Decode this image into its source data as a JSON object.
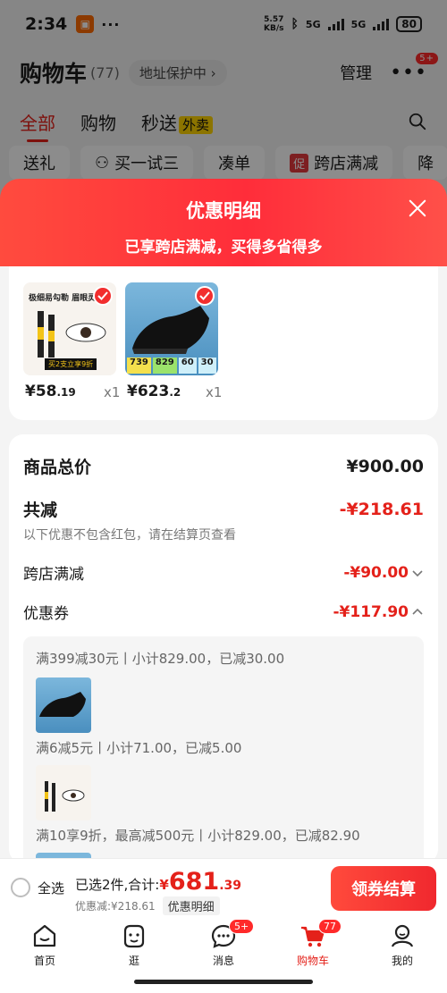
{
  "status": {
    "time": "2:34",
    "net_speed": "5.57\nKB/s",
    "net": "5G",
    "battery": "80"
  },
  "header": {
    "title": "购物车",
    "count": "(77)",
    "address": "地址保护中 ›",
    "manage": "管理",
    "more_badge": "5+"
  },
  "tabs": [
    {
      "label": "全部"
    },
    {
      "label": "购物"
    },
    {
      "label": "秒送"
    }
  ],
  "tab_tag": "外卖",
  "filters": [
    {
      "label": "送礼"
    },
    {
      "label": "买一试三"
    },
    {
      "label": "凑单"
    },
    {
      "label": "跨店满减",
      "badge": "促"
    },
    {
      "label": "降"
    }
  ],
  "sheet": {
    "title": "优惠明细",
    "subtitle": "已享跨店满减，买得多省得多"
  },
  "products": [
    {
      "price_int": "¥58",
      "price_dec": ".19",
      "qty": "x1",
      "img_title": "极细易勾勒 眉眼灵动",
      "img_promo": "买2支立享9折"
    },
    {
      "price_int": "¥623",
      "price_dec": ".2",
      "qty": "x1",
      "img_prices": [
        "739",
        "829",
        "60",
        "30"
      ]
    }
  ],
  "summary": {
    "total_label": "商品总价",
    "total_value": "¥900.00",
    "reduce_label": "共减",
    "reduce_value": "-¥218.61",
    "note": "以下优惠不包含红包，请在结算页查看",
    "cross_label": "跨店满减",
    "cross_value": "-¥90.00",
    "coupon_label": "优惠券",
    "coupon_value": "-¥117.90"
  },
  "coupon_details": [
    {
      "text": "满399减30元丨小计829.00，已减30.00"
    },
    {
      "text": "满6减5元丨小计71.00，已减5.00"
    },
    {
      "text": "满10享9折，最高减500元丨小计829.00，已减82.90"
    }
  ],
  "checkout": {
    "select_all": "全选",
    "selected_text": "已选2件,合计:",
    "total_currency": "¥",
    "total_int": "681",
    "total_dec": ".39",
    "discount_text": "优惠减:¥218.61",
    "detail_btn": "优惠明细",
    "button": "领券结算"
  },
  "nav": [
    {
      "label": "首页"
    },
    {
      "label": "逛"
    },
    {
      "label": "消息",
      "badge": "5+"
    },
    {
      "label": "购物车",
      "badge": "77"
    },
    {
      "label": "我的"
    }
  ],
  "colors": {
    "accent": "#e4211a",
    "sheet_gradient_start": "#ff4b3e",
    "sheet_gradient_end": "#ff2d3a"
  }
}
